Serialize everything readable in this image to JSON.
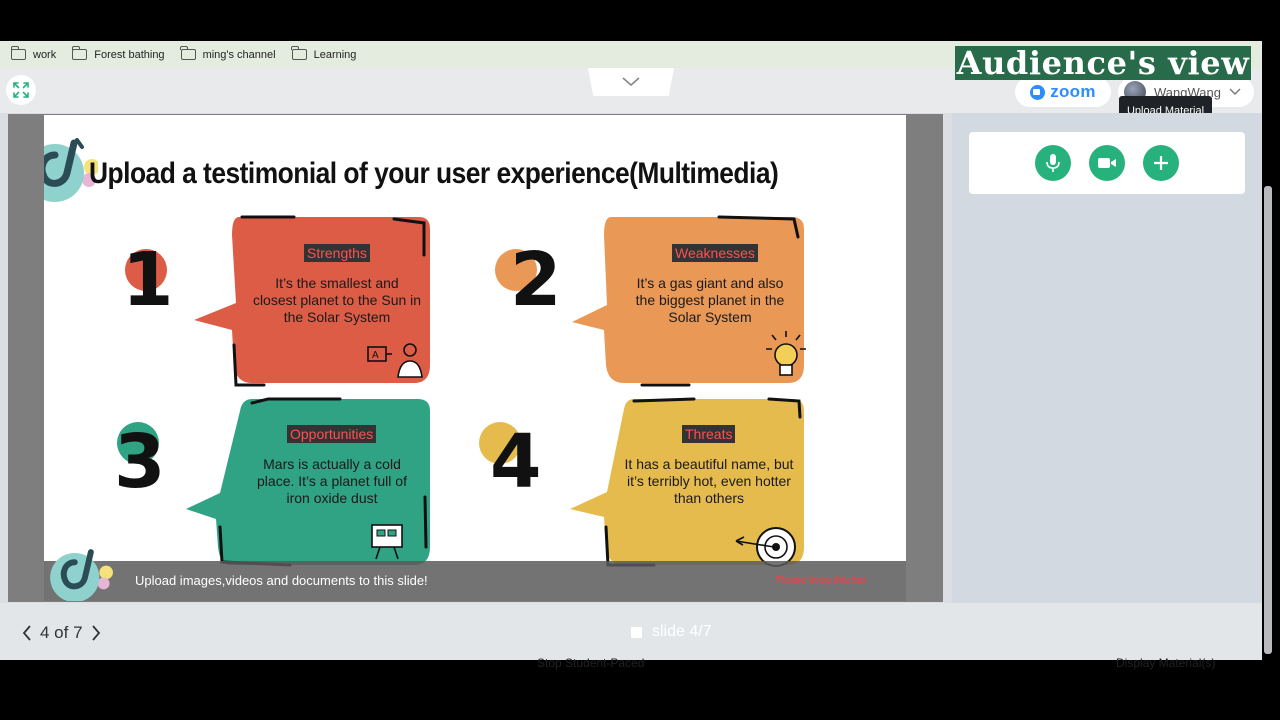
{
  "bookmarks": [
    "work",
    "Forest bathing",
    "ming's channel",
    "Learning"
  ],
  "header": {
    "overlay_label": "Audience's view",
    "zoom_label": "zoom",
    "user_name": "WangWang",
    "tooltip": "Upload Material"
  },
  "slide": {
    "title": "Upload a testimonial of your user experience(Multimedia)",
    "cards": [
      {
        "number": "1",
        "label": "Strengths",
        "text": "It’s the smallest and closest planet to the Sun in the Solar System",
        "color": "#dc5c46"
      },
      {
        "number": "2",
        "label": "Weaknesses",
        "text": "It’s a gas giant and also the biggest planet in the Solar System",
        "color": "#ea9856"
      },
      {
        "number": "3",
        "label": "Opportunities",
        "text": "Mars is actually a cold place. It’s a planet full of iron oxide dust",
        "color": "#2fa383"
      },
      {
        "number": "4",
        "label": "Threats",
        "text": "It has a beautiful name, but it’s terribly hot, even hotter than others",
        "color": "#e5bb4d"
      }
    ],
    "upload_bar_text": "Upload images,videos and documents to this slide!",
    "keep_bar_text": "Please keep this bar"
  },
  "panel": {
    "tools": [
      {
        "name": "microphone-icon"
      },
      {
        "name": "video-camera-icon"
      },
      {
        "name": "plus-icon"
      }
    ]
  },
  "footer": {
    "pager": "4 of 7",
    "slide_indicator": "slide 4/7",
    "behind_left": "Stop Student-Paced",
    "behind_right": "Display Material(s)"
  },
  "colors": {
    "accent": "#27b27d",
    "zoom_blue": "#2d8cff",
    "overlay_green": "#286b4a"
  }
}
